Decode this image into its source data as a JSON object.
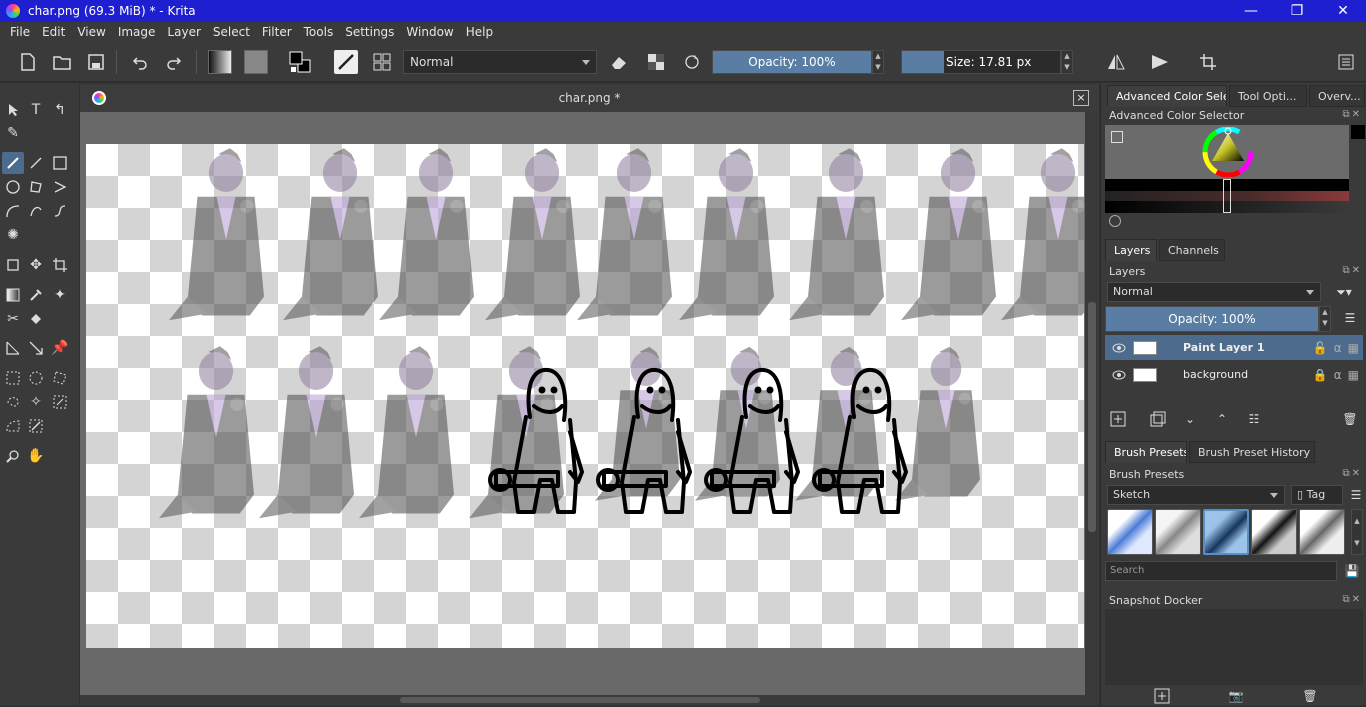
{
  "window": {
    "title": "char.png (69.3 MiB)  * - Krita",
    "minimize": "—",
    "maximize": "❐",
    "close": "✕"
  },
  "menu": [
    "File",
    "Edit",
    "View",
    "Image",
    "Layer",
    "Select",
    "Filter",
    "Tools",
    "Settings",
    "Window",
    "Help"
  ],
  "toolbar": {
    "blend_mode": "Normal",
    "opacity_label": "Opacity: 100%",
    "opacity_value": 100,
    "size_label": "Size: 17.81 px"
  },
  "document": {
    "tab_title": "char.png *",
    "close": "×"
  },
  "docker": {
    "top_tabs": [
      "Advanced Color Sele...",
      "Tool Opti...",
      "Overv..."
    ],
    "color_selector_title": "Advanced Color Selector",
    "layer_tabs": [
      "Layers",
      "Channels"
    ],
    "layers_title": "Layers",
    "layers_blend": "Normal",
    "layers_opacity_label": "Opacity:  100%",
    "layers": [
      {
        "name": "Paint Layer 1",
        "selected": true
      },
      {
        "name": "background",
        "selected": false
      }
    ],
    "brush_tabs": [
      "Brush Presets",
      "Brush Preset History"
    ],
    "brush_presets_title": "Brush Presets",
    "brush_tag": "Sketch",
    "tag_label": "Tag",
    "search_placeholder": "Search",
    "snapshot_title": "Snapshot Docker"
  },
  "colors": {
    "titlebar": "#1f1fd2",
    "accent": "#4d6b8c",
    "panel": "#3a3a3a",
    "canvas_bg": "#696969"
  }
}
